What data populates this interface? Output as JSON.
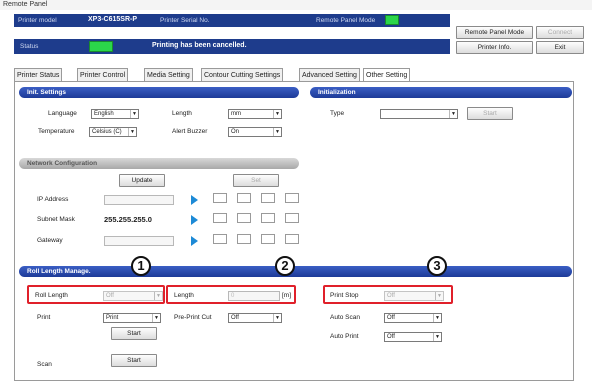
{
  "window": {
    "title": "Remote Panel"
  },
  "header": {
    "printer_model_label": "Printer model",
    "printer_model_value": "XP3-C615SR-P",
    "printer_serial_label": "Printer Serial No.",
    "remote_panel_mode_label": "Remote Panel Mode",
    "status_label": "Status",
    "status_text": "Printing has been cancelled.",
    "status_color": "#2bd64a",
    "buttons": {
      "remote_panel_mode": "Remote Panel Mode",
      "connect": "Connect",
      "printer_info": "Printer Info.",
      "exit": "Exit"
    }
  },
  "tabs": [
    {
      "label": "Printer Status"
    },
    {
      "label": "Printer Control"
    },
    {
      "label": "Media Setting"
    },
    {
      "label": "Contour Cutting Settings"
    },
    {
      "label": "Advanced Setting"
    },
    {
      "label": "Other Setting"
    }
  ],
  "init_settings": {
    "title": "Init. Settings",
    "language_label": "Language",
    "language_value": "English",
    "length_label": "Length",
    "length_value": "mm",
    "temperature_label": "Temperature",
    "temperature_value": "Celsius (C)",
    "alert_buzzer_label": "Alert Buzzer",
    "alert_buzzer_value": "On"
  },
  "initialization": {
    "title": "Initialization",
    "type_label": "Type",
    "type_value": "",
    "button": "Start"
  },
  "network": {
    "title": "Network Configuration",
    "update_button": "Update",
    "set_button": "Set",
    "ip_label": "IP Address",
    "subnet_label": "Subnet Mask",
    "subnet_value": "255.255.255.0",
    "gateway_label": "Gateway"
  },
  "roll_length": {
    "title": "Roll Length Manage.",
    "roll_length_label": "Roll Length",
    "roll_length_value": "Off",
    "length_label": "Length",
    "length_value": "0",
    "length_unit": "[m]",
    "print_stop_label": "Print Stop",
    "print_stop_value": "Off",
    "print_label": "Print",
    "print_value": "Print",
    "preprint_cut_label": "Pre-Print Cut",
    "preprint_cut_value": "Off",
    "auto_scan_label": "Auto Scan",
    "auto_scan_value": "Off",
    "auto_print_label": "Auto Print",
    "auto_print_value": "Off",
    "start_button": "Start",
    "scan_label": "Scan",
    "scan_button": "Start"
  },
  "callouts": [
    "1",
    "2",
    "3"
  ],
  "colors": {
    "accent": "#1e3c8c",
    "highlight": "#e0202a"
  }
}
